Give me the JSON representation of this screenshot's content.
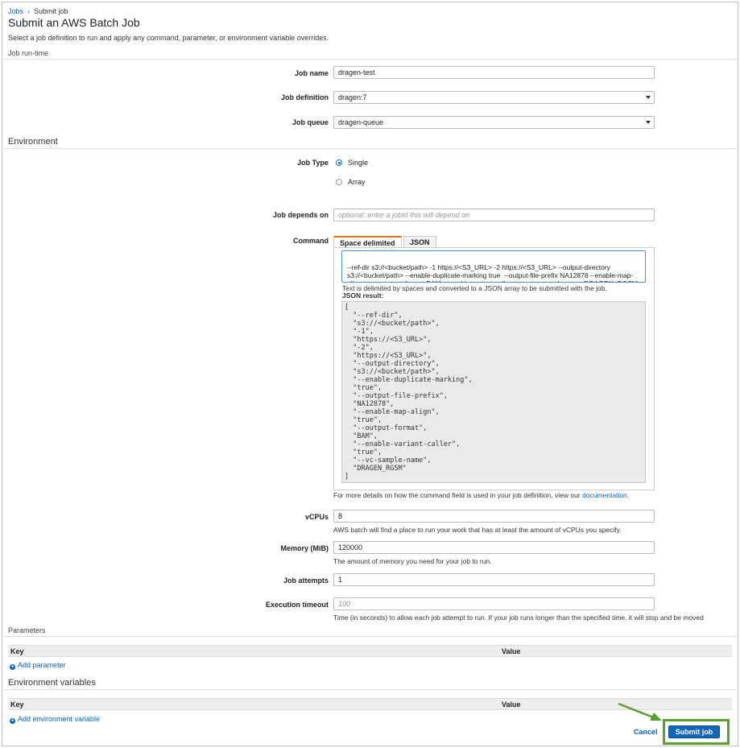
{
  "breadcrumb": {
    "root": "Jobs",
    "sep": "›",
    "current": "Submit job"
  },
  "page": {
    "title": "Submit an AWS Batch Job",
    "description": "Select a job definition to run and apply any command, parameter, or environment variable overrides."
  },
  "section_runtime": "Job run-time",
  "job_name": {
    "label": "Job name",
    "value": "dragen-test"
  },
  "job_definition": {
    "label": "Job definition",
    "value": "dragen:7"
  },
  "job_queue": {
    "label": "Job queue",
    "value": "dragen-queue"
  },
  "section_environment": "Environment",
  "job_type": {
    "label": "Job Type",
    "options": [
      "Single",
      "Array"
    ],
    "selected": "Single"
  },
  "job_depends_on": {
    "label": "Job depends on",
    "placeholder": "optional: enter a jobId this will depend on"
  },
  "command": {
    "label": "Command",
    "tabs": [
      "Space delimited",
      "JSON"
    ],
    "active_tab": "Space delimited",
    "text": "--ref-dir s3://<bucket/path> -1 https://<S3_URL> -2 https://<S3_URL> --output-directory s3://<bucket/path> --enable-duplicate-marking true  --output-file-prefix NA12878 --enable-map-align true  --output-format BAM  --enable-variant-caller true --vc-sample-name DRAGEN_RGSM",
    "help": "Text is delimited by spaces and converted to a JSON array to be submitted with the job.",
    "json_label": "JSON result:",
    "json_result": "[\n  \"--ref-dir\",\n  \"s3://<bucket/path>\",\n  \"-1\",\n  \"https://<S3_URL>\",\n  \"-2\",\n  \"https://<S3_URL>\",\n  \"--output-directory\",\n  \"s3://<bucket/path>\",\n  \"--enable-duplicate-marking\",\n  \"true\",\n  \"--output-file-prefix\",\n  \"NA12878\",\n  \"--enable-map-align\",\n  \"true\",\n  \"--output-format\",\n  \"BAM\",\n  \"--enable-variant-caller\",\n  \"true\",\n  \"--vc-sample-name\",\n  \"DRAGEN_RGSM\"\n]",
    "doc_help_prefix": "For more details on how the command field is used in your job definition, view our",
    "doc_link": "documentation",
    "doc_help_suffix": "."
  },
  "vcpus": {
    "label": "vCPUs",
    "value": "8",
    "help": "AWS batch will find a place to run your work that has at least the amount of vCPUs you specify."
  },
  "memory": {
    "label": "Memory (MiB)",
    "value": "120000",
    "help": "The amount of memory you need for your job to run."
  },
  "job_attempts": {
    "label": "Job attempts",
    "value": "1"
  },
  "execution_timeout": {
    "label": "Execution timeout",
    "placeholder": "100",
    "help": "Time (in seconds) to allow each job attempt to run. If your job runs longer than the specified time, it will stop and be moved"
  },
  "parameters": {
    "title": "Parameters",
    "col_key": "Key",
    "col_value": "Value",
    "add_label": "Add parameter"
  },
  "env_vars": {
    "title": "Environment variables",
    "col_key": "Key",
    "col_value": "Value",
    "add_label": "Add environment variable"
  },
  "actions": {
    "cancel": "Cancel",
    "submit": "Submit job"
  },
  "colors": {
    "primary": "#1166bb",
    "link": "#0066c0",
    "active_tab": "#ec7211",
    "highlight": "#5aa02c"
  }
}
